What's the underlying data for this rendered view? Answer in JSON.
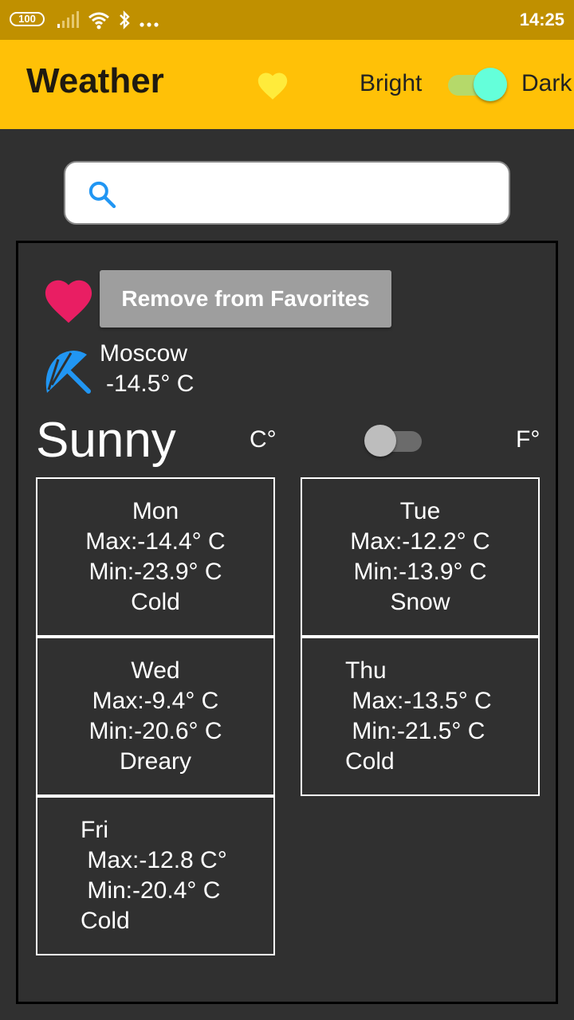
{
  "status_bar": {
    "battery": "100",
    "time": "14:25"
  },
  "app_bar": {
    "title": "Weather",
    "bright_label": "Bright",
    "dark_label": "Dark",
    "dark_mode_on": true
  },
  "search": {
    "value": "",
    "placeholder": ""
  },
  "location": {
    "favorite_button_label": "Remove from Favorites",
    "city": "Moscow",
    "temperature": "-14.5° C",
    "condition": "Sunny",
    "unit_c": "C°",
    "unit_f": "F°",
    "fahrenheit_on": false
  },
  "forecast": [
    {
      "day": "Mon",
      "max": "Max:-14.4° C",
      "min": "Min:-23.9° C",
      "desc": "Cold"
    },
    {
      "day": "Tue",
      "max": "Max:-12.2° C",
      "min": "Min:-13.9° C",
      "desc": "Snow"
    },
    {
      "day": "Wed",
      "max": "Max:-9.4° C",
      "min": "Min:-20.6° C",
      "desc": "Dreary"
    },
    {
      "day": "Thu",
      "max": " Max:-13.5° C",
      "min": " Min:-21.5° C",
      "desc": "Cold"
    },
    {
      "day": "Fri",
      "max": " Max:-12.8 C°",
      "min": " Min:-20.4° C",
      "desc": "Cold"
    }
  ],
  "colors": {
    "accent": "#FFC107",
    "status_bar": "#C09000",
    "heart": "#E91E63",
    "appbar_heart": "#FFEB3B",
    "umbrella": "#2196F3",
    "toggle_knob": "#64FFDA"
  },
  "icons": {
    "favorite": "heart-icon",
    "location": "umbrella-icon",
    "search": "search-icon"
  }
}
